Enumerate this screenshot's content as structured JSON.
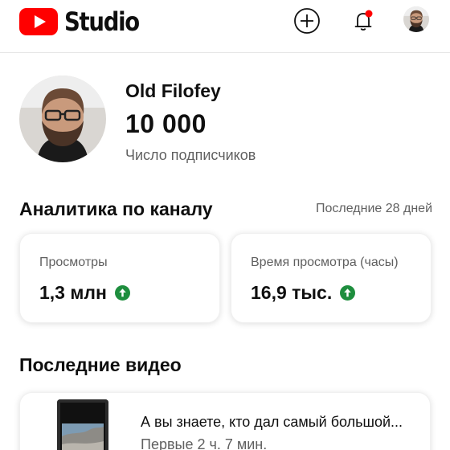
{
  "header": {
    "logo_text": "Studio",
    "icons": [
      "create-icon",
      "notifications-icon",
      "account-avatar"
    ],
    "notification_dot_color": "#ff0000",
    "brand_color": "#ff0000"
  },
  "channel": {
    "name": "Old Filofey",
    "subscribers": "10 000",
    "subscribers_label": "Число подписчиков"
  },
  "analytics": {
    "title": "Аналитика по каналу",
    "period": "Последние 28 дней",
    "cards": [
      {
        "label": "Просмотры",
        "value": "1,3 млн",
        "trend_icon": "arrow-up-icon"
      },
      {
        "label": "Время просмотра (часы)",
        "value": "16,9 тыс.",
        "trend_icon": "arrow-up-icon"
      }
    ],
    "trend_color": "#1e8e3e"
  },
  "latest_videos": {
    "title": "Последние видео",
    "items": [
      {
        "title": "А вы знаете, кто дал самый большой...",
        "meta": "Первые 2 ч. 7 мин."
      }
    ]
  }
}
